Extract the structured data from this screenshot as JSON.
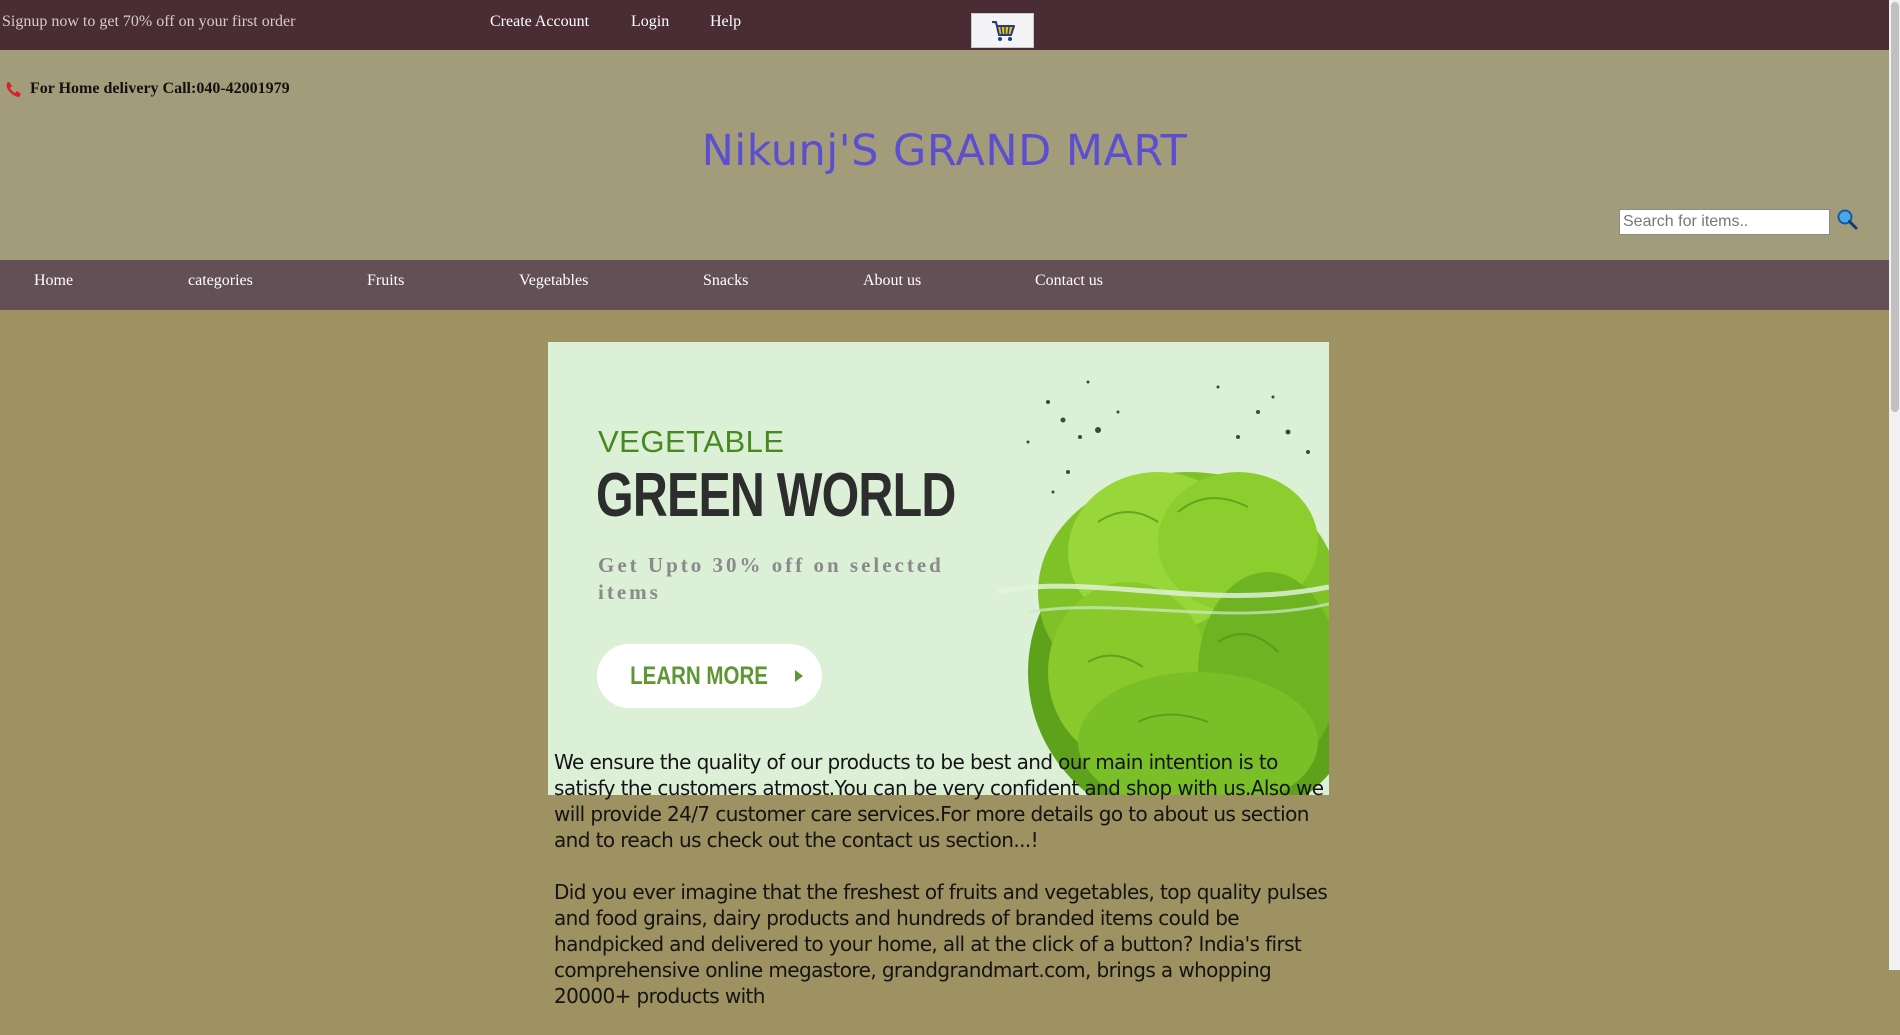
{
  "topbar": {
    "promo": "Signup now to get 70% off on your first order",
    "links": [
      "Create Account",
      "Login",
      "Help"
    ],
    "cart_icon": "shopping-cart-icon"
  },
  "header": {
    "phone_icon": "phone-icon",
    "delivery_text": "For Home delivery Call:040-42001979",
    "site_title": "Nikunj'S GRAND MART",
    "search": {
      "placeholder": "Search for items..",
      "value": ""
    },
    "search_icon": "magnifier-icon"
  },
  "nav": [
    "Home",
    "categories",
    "Fruits",
    "Vegetables",
    "Snacks",
    "About us",
    "Contact us"
  ],
  "banner": {
    "kicker": "VEGETABLE",
    "headline": "GREEN WORLD",
    "offer": "Get Upto 30% off on selected items",
    "button": "LEARN MORE",
    "image": "lettuce-splash-image"
  },
  "content": {
    "para1": "We ensure the quality of our products to be best and our main intention is to satisfy the customers atmost.You can be very confident and shop with us.Also we will provide 24/7 customer care services.For more details go to about us section and to reach us check out the contact us section...!",
    "para2": "Did you ever imagine that the freshest of fruits and vegetables, top quality pulses and food grains, dairy products and hundreds of branded items could be handpicked and delivered to your home, all at the click of a button? India's first comprehensive online megastore, grandgrandmart.com, brings a whopping 20000+ products with"
  },
  "colors": {
    "topbar": "#4a2c34",
    "header": "#a39c7a",
    "nav": "#625056",
    "page": "#9e9162",
    "title": "#5b4fd0",
    "banner_bg": "#dcefd7"
  }
}
